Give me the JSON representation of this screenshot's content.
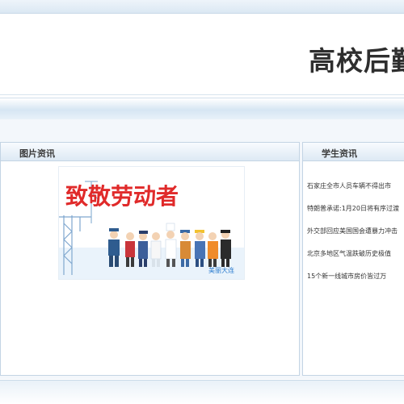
{
  "header": {
    "title": "高校后勤"
  },
  "left_panel": {
    "title": "图片资讯",
    "picture": {
      "headline": "致敬劳动者",
      "caption": "美丽大连"
    }
  },
  "right_panel": {
    "title": "学生资讯",
    "items": [
      {
        "text": "石家庄全市人员车辆不得出市"
      },
      {
        "text": "特朗普承诺:1月20日将有序过渡"
      },
      {
        "text": "外交部回应美国国会遭暴力冲击"
      },
      {
        "text": "北京多地区气温跌破历史极值"
      },
      {
        "text": "15个新一线城市房价皆过万"
      }
    ]
  },
  "colors": {
    "accent_blue": "#dbe8f3",
    "title_text": "#2e2e2e",
    "poster_red": "#e02a2a"
  }
}
